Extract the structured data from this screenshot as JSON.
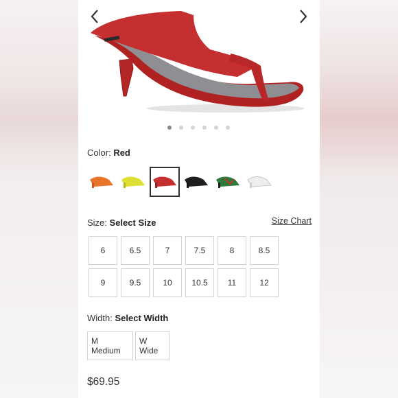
{
  "gallery": {
    "prev_icon": "chevron-left-icon",
    "next_icon": "chevron-right-icon",
    "dot_count": 6,
    "active_dot": 1,
    "product_color": "#c62f2f"
  },
  "color": {
    "label": "Color:",
    "value": "Red",
    "swatches": [
      {
        "name": "orange",
        "hex": "#e8732a"
      },
      {
        "name": "yellow",
        "hex": "#dde033"
      },
      {
        "name": "red",
        "hex": "#c62f2f",
        "selected": true
      },
      {
        "name": "black",
        "hex": "#1f1f1f"
      },
      {
        "name": "multi",
        "hex": "#2d7a3a"
      },
      {
        "name": "white",
        "hex": "#eeeeee"
      }
    ]
  },
  "size": {
    "label": "Size:",
    "value": "Select Size",
    "chart_link": "Size Chart",
    "options": [
      "6",
      "6.5",
      "7",
      "7.5",
      "8",
      "8.5",
      "9",
      "9.5",
      "10",
      "10.5",
      "11",
      "12"
    ]
  },
  "width": {
    "label": "Width:",
    "value": "Select Width",
    "options": [
      "M Medium",
      "W Wide"
    ]
  },
  "price": "$69.95"
}
